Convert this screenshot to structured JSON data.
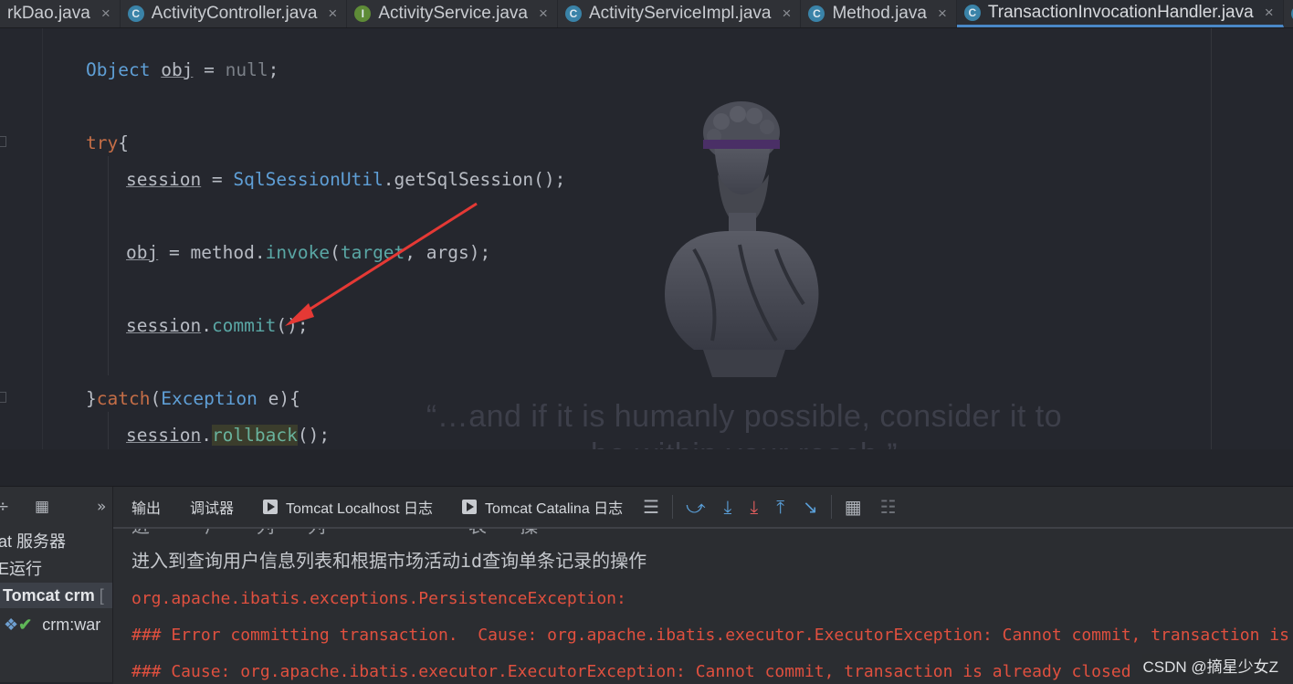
{
  "tabs": [
    {
      "label": "rkDao.java",
      "icon": "",
      "active": false,
      "closable": false
    },
    {
      "label": "ActivityController.java",
      "icon": "class-icon",
      "active": false,
      "closable": true
    },
    {
      "label": "ActivityService.java",
      "icon": "interface-icon",
      "active": false,
      "closable": true
    },
    {
      "label": "ActivityServiceImpl.java",
      "icon": "class-icon",
      "active": false,
      "closable": true
    },
    {
      "label": "Method.java",
      "icon": "class-icon",
      "active": false,
      "closable": true
    },
    {
      "label": "TransactionInvocationHandler.java",
      "icon": "class-icon",
      "active": true,
      "closable": true
    }
  ],
  "tab_close_glyph": "×",
  "code": {
    "line1": {
      "type": "Object",
      "var": "obj",
      "eq": " = ",
      "null": "null",
      "end": ";"
    },
    "line2": {
      "kw": "try",
      "brace": "{"
    },
    "line3": {
      "field": "session",
      "eq": " = ",
      "type": "SqlSessionUtil",
      "call": ".getSqlSession();"
    },
    "line4": {
      "var": "obj",
      "eq": " = method.",
      "meth": "invoke",
      "open": "(",
      "target": "target",
      "rest": ", args);"
    },
    "line5": {
      "field": "session",
      "dot": ".",
      "meth": "commit",
      "end": "();"
    },
    "line6": {
      "brace": "}",
      "kw": "catch",
      "open": "(",
      "type": "Exception",
      "rest": " e){"
    },
    "line7": {
      "field": "session",
      "dot": ".",
      "meth": "rollback",
      "end": "();"
    }
  },
  "wallpaper": {
    "quote_line1": "“…and if it is humanly possible, consider it to",
    "quote_line2": "be within your reach.”"
  },
  "services": {
    "rows": [
      {
        "text": "at 服务器",
        "selected": false
      },
      {
        "text": "E运行",
        "selected": false
      },
      {
        "text": "Tomcat crm",
        "suffix": "[",
        "selected": true
      },
      {
        "text": "crm:war",
        "selected": false
      }
    ]
  },
  "console_tabs": [
    {
      "label": "输出",
      "has_icon": false
    },
    {
      "label": "调试器",
      "has_icon": false
    },
    {
      "label": "Tomcat Localhost 日志",
      "has_icon": true
    },
    {
      "label": "Tomcat Catalina 日志",
      "has_icon": true
    }
  ],
  "console": {
    "line_partial": "进 · · 户 · 列 · 列 · · · · · · 表 · 操",
    "line_info": "进入到查询用户信息列表和根据市场活动id查询单条记录的操作",
    "line_err1": "org.apache.ibatis.exceptions.PersistenceException:",
    "line_err2": "### Error committing transaction.  Cause: org.apache.ibatis.executor.ExecutorException: Cannot commit, transaction is",
    "line_err3": "### Cause: org.apache.ibatis.executor.ExecutorException: Cannot commit, transaction is already closed"
  },
  "watermark": "CSDN @摘星少女Z",
  "colors": {
    "accent": "#4a88c7",
    "error": "#e0503f",
    "arrow": "#e53935"
  }
}
